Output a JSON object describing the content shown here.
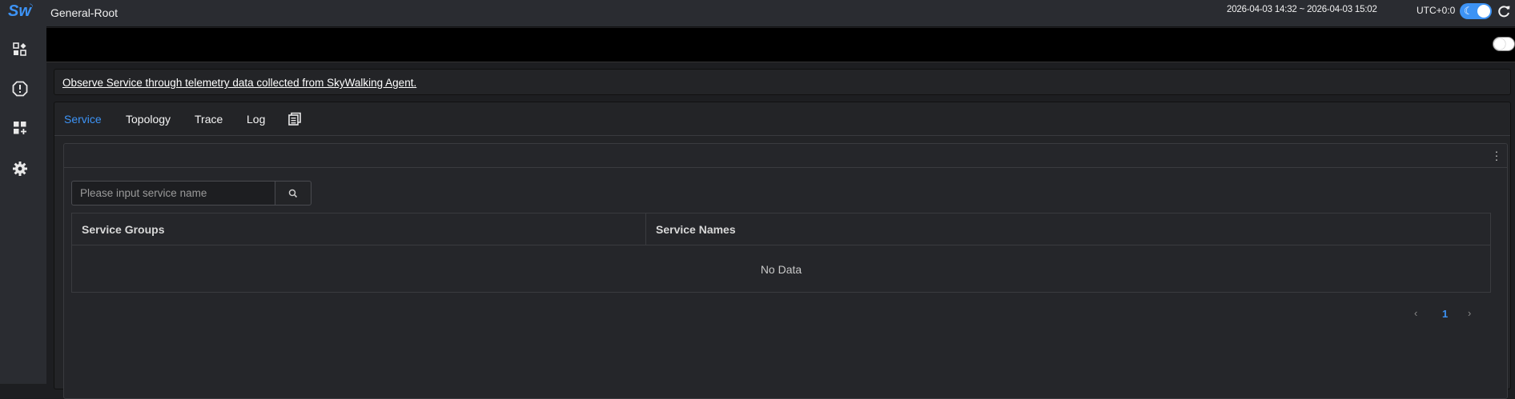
{
  "app": {
    "logo_text": "Sw",
    "page_title": "General-Root"
  },
  "header": {
    "time_range": "2026-04-03 14:32 ~ 2026-04-03 15:02",
    "timezone": "UTC+0:0",
    "theme": "dark"
  },
  "sidebar": {
    "items": [
      {
        "icon": "dashboard-icon"
      },
      {
        "icon": "alert-icon"
      },
      {
        "icon": "widgets-icon"
      },
      {
        "icon": "gear-icon"
      }
    ]
  },
  "description": {
    "text": "Observe Service through telemetry data collected from SkyWalking Agent."
  },
  "tabs": [
    {
      "label": "Service",
      "active": true
    },
    {
      "label": "Topology",
      "active": false
    },
    {
      "label": "Trace",
      "active": false
    },
    {
      "label": "Log",
      "active": false
    }
  ],
  "search": {
    "placeholder": "Please input service name",
    "value": ""
  },
  "table": {
    "headers": [
      "Service Groups",
      "Service Names"
    ],
    "empty_text": "No Data"
  },
  "pagination": {
    "current_page": "1",
    "prev": "‹",
    "next": "›"
  },
  "colors": {
    "accent": "#3d93f5",
    "background": "#1d1e21",
    "panel": "#232427"
  }
}
